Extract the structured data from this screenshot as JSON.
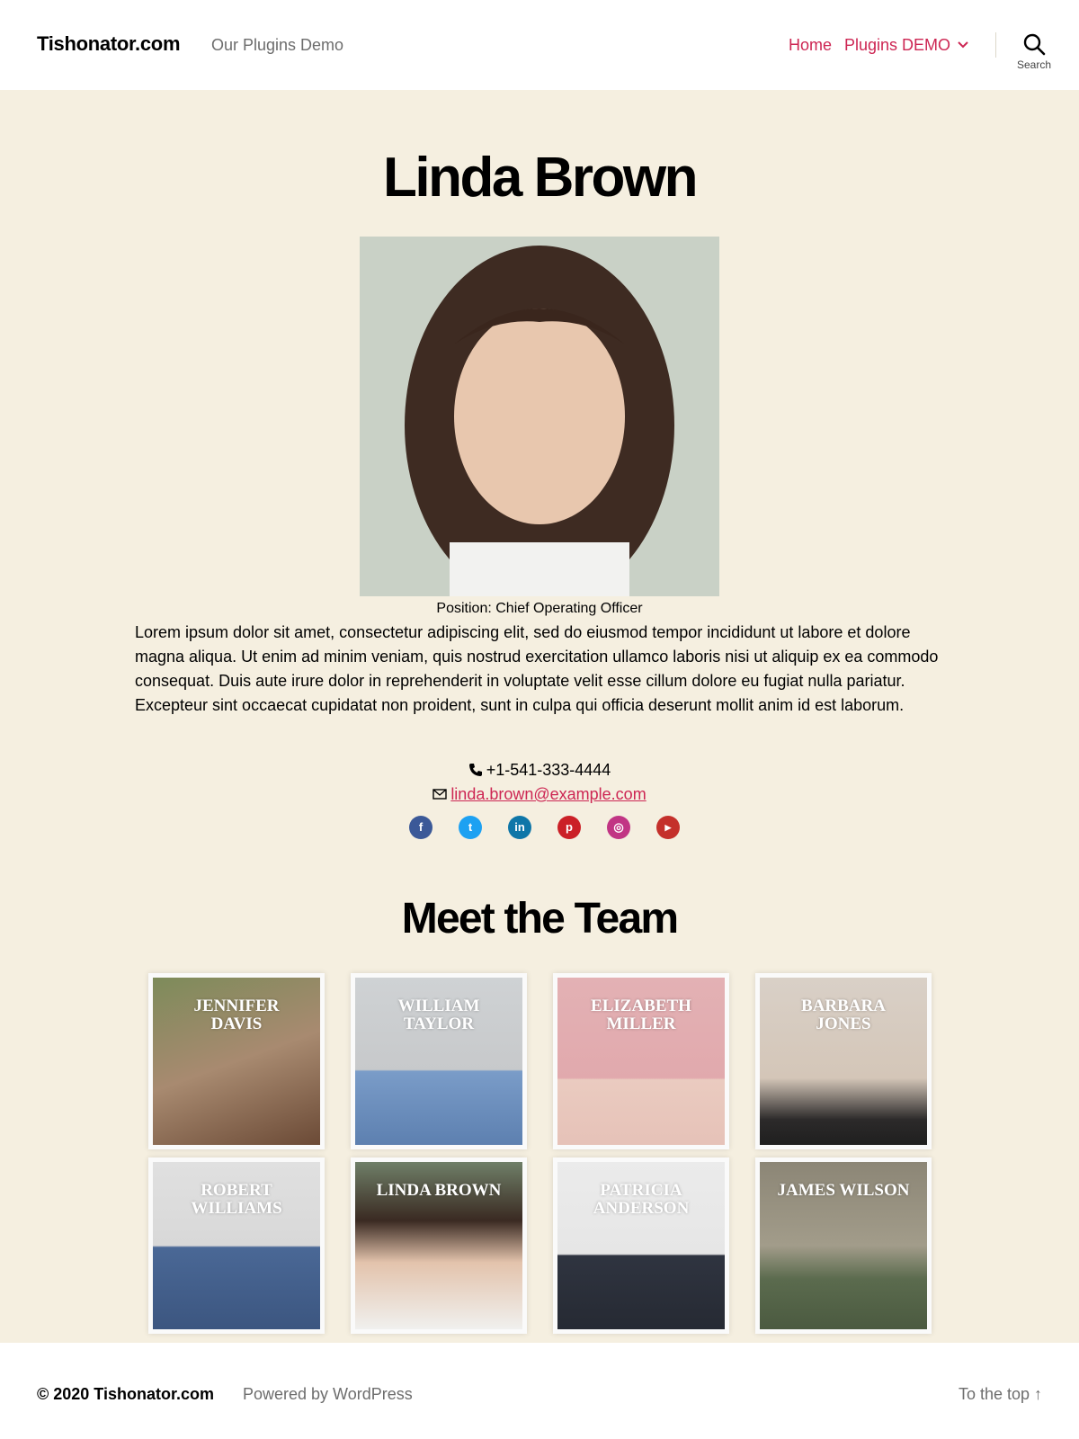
{
  "header": {
    "site_title": "Tishonator.com",
    "site_description": "Our Plugins Demo",
    "nav": {
      "home": "Home",
      "plugins": "Plugins DEMO",
      "search_label": "Search"
    }
  },
  "profile": {
    "name": "Linda Brown",
    "position": "Position: Chief Operating Officer",
    "bio": "Lorem ipsum dolor sit amet, consectetur adipiscing elit, sed do eiusmod tempor incididunt ut labore et dolore magna aliqua. Ut enim ad minim veniam, quis nostrud exercitation ullamco laboris nisi ut aliquip ex ea commodo consequat. Duis aute irure dolor in reprehenderit in voluptate velit esse cillum dolore eu fugiat nulla pariatur. Excepteur sint occaecat cupidatat non proident, sunt in culpa qui officia deserunt mollit anim id est laborum.",
    "phone": "+1-541-333-4444",
    "email": "linda.brown@example.com",
    "socials": [
      {
        "icon": "facebook-icon",
        "color": "#3b5998"
      },
      {
        "icon": "twitter-icon",
        "color": "#1da1f2"
      },
      {
        "icon": "linkedin-icon",
        "color": "#0e76a8"
      },
      {
        "icon": "pinterest-icon",
        "color": "#cb2027"
      },
      {
        "icon": "instagram-icon",
        "color": "#c13584"
      },
      {
        "icon": "youtube-icon",
        "color": "#c4302b"
      }
    ]
  },
  "team": {
    "title": "Meet the Team",
    "members": [
      {
        "name": "JENNIFER DAVIS"
      },
      {
        "name": "WILLIAM TAYLOR"
      },
      {
        "name": "ELIZABETH MILLER"
      },
      {
        "name": "BARBARA JONES"
      },
      {
        "name": "ROBERT WILLIAMS"
      },
      {
        "name": "LINDA BROWN"
      },
      {
        "name": "PATRICIA ANDERSON"
      },
      {
        "name": "JAMES WILSON"
      }
    ]
  },
  "footer": {
    "copyright": "© 2020 Tishonator.com",
    "powered": "Powered by WordPress",
    "to_top": "To the top ↑"
  }
}
